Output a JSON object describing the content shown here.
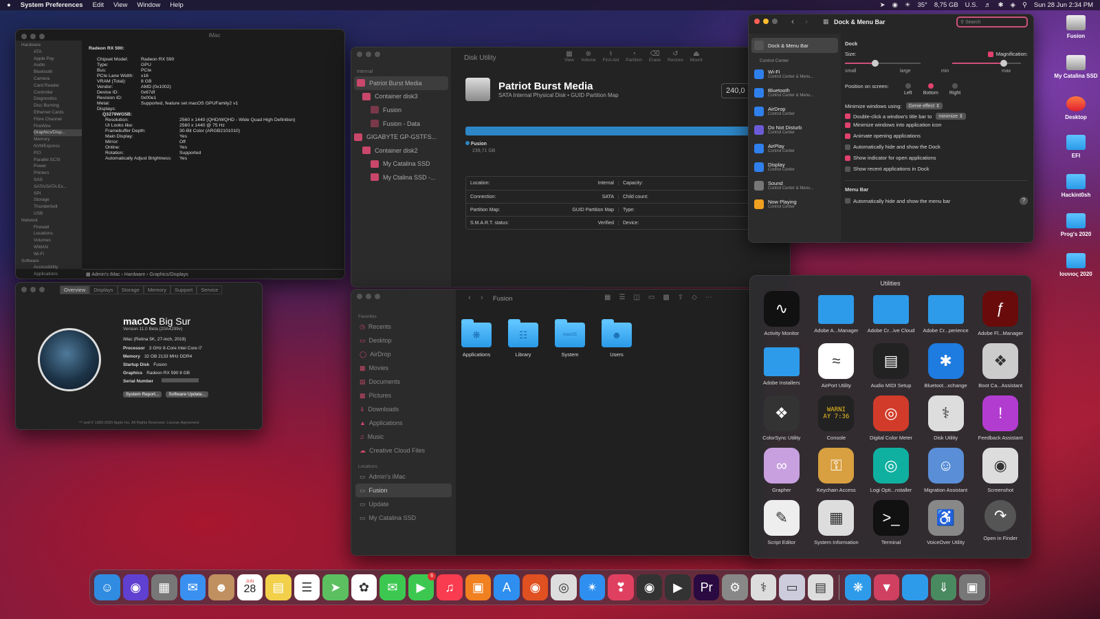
{
  "menubar": {
    "apple": "",
    "app": "System Preferences",
    "items": [
      "Edit",
      "View",
      "Window",
      "Help"
    ],
    "temp": "35°",
    "disk": "8,75 GB",
    "locale": "U.S.",
    "clock": "Sun 28 Jun  2:34 PM"
  },
  "sysinfo": {
    "title": "iMac",
    "sidebar": [
      "Hardware",
      "ATA",
      "Apple Pay",
      "Audio",
      "Bluetooth",
      "Camera",
      "Card Reader",
      "Controller",
      "Diagnostics",
      "Disc Burning",
      "Ethernet Cards",
      "Fibre Channel",
      "FireWire",
      "Graphics/Disp...",
      "Memory",
      "NVMExpress",
      "PCI",
      "Parallel SCSI",
      "Power",
      "Printers",
      "SAS",
      "SATA/SATA Ex...",
      "SPI",
      "Storage",
      "Thunderbolt",
      "USB",
      "Network",
      "Firewall",
      "Locations",
      "Volumes",
      "WWAN",
      "Wi-Fi",
      "Software",
      "Accessibility",
      "Applications",
      "Developer"
    ],
    "heading": "Radeon RX 590:",
    "rows": [
      [
        "Chipset Model:",
        "Radeon RX 590"
      ],
      [
        "Type:",
        "GPU"
      ],
      [
        "Bus:",
        "PCIe"
      ],
      [
        "PCIe Lane Width:",
        "x16"
      ],
      [
        "VRAM (Total):",
        "8 GB"
      ],
      [
        "Vendor:",
        "AMD (0x1002)"
      ],
      [
        "Device ID:",
        "0x67df"
      ],
      [
        "Revision ID:",
        "0x00e1"
      ],
      [
        "Metal:",
        "Supported, feature set macOS GPUFamily2 v1"
      ],
      [
        "Displays:",
        ""
      ]
    ],
    "display_name": "Q3279WG5B:",
    "display_rows": [
      [
        "Resolution:",
        "2560 x 1440 (QHD/WQHD - Wide Quad High Definition)"
      ],
      [
        "UI Looks like:",
        "2560 x 1440 @ 75 Hz"
      ],
      [
        "Framebuffer Depth:",
        "30-Bit Color (ARGB2101010)"
      ],
      [
        "Main Display:",
        "Yes"
      ],
      [
        "Mirror:",
        "Off"
      ],
      [
        "Online:",
        "Yes"
      ],
      [
        "Rotation:",
        "Supported"
      ],
      [
        "Automatically Adjust Brightness:",
        "Yes"
      ]
    ],
    "path": "Admin's iMac › Hardware › Graphics/Displays"
  },
  "about": {
    "tabs": [
      "Overview",
      "Displays",
      "Storage",
      "Memory",
      "Support",
      "Service"
    ],
    "os": "macOS",
    "os_name": "Big Sur",
    "version": "Version 11.0 Beta (20A4299v)",
    "model": "iMac (Retina 5K, 27-inch, 2019)",
    "specs": [
      [
        "Processor",
        "3 GHz 8-Core Intel Core i7"
      ],
      [
        "Memory",
        "32 GB 2133 MHz DDR4"
      ],
      [
        "Startup Disk",
        "Fusion"
      ],
      [
        "Graphics",
        "Radeon RX 590 8 GB"
      ],
      [
        "Serial Number",
        ""
      ]
    ],
    "btn_report": "System Report...",
    "btn_update": "Software Update...",
    "footer": "™ and © 1983-2020 Apple Inc. All Rights Reserved. License Agreement"
  },
  "disk": {
    "title": "Disk Utility",
    "toolbar": [
      "View",
      "Volume",
      "First Aid",
      "Partition",
      "Erase",
      "Restore",
      "Mount"
    ],
    "section": "Internal",
    "tree": [
      "Patriot Burst Media",
      "Container disk3",
      "Fusion",
      "Fusion - Data",
      "GIGABYTE GP-GSTFS...",
      "Container disk2",
      "My Catalina SSD",
      "My Ctalina SSD -..."
    ],
    "name": "Patriot Burst Media",
    "sub": "SATA Internal Physical Disk • GUID Partition Map",
    "size": "240,0",
    "vol": "Fusion",
    "vol_size": "239,71 GB",
    "info": [
      [
        "Location:",
        "Internal",
        "Capacity:",
        "24"
      ],
      [
        "Connection:",
        "SATA",
        "Child count:",
        ""
      ],
      [
        "Partition Map:",
        "GUID Partition Map",
        "Type:",
        "Sc"
      ],
      [
        "S.M.A.R.T. status:",
        "Verified",
        "Device:",
        ""
      ]
    ]
  },
  "finder": {
    "title": "Fusion",
    "fav_label": "Favorites",
    "favorites": [
      "Recents",
      "Desktop",
      "AirDrop",
      "Movies",
      "Documents",
      "Pictures",
      "Downloads",
      "Applications",
      "Music",
      "Creative Cloud Files"
    ],
    "loc_label": "Locations",
    "locations": [
      "Admin's iMac",
      "Fusion",
      "Update",
      "My Catalina SSD"
    ],
    "items": [
      "Applications",
      "Library",
      "System",
      "Users"
    ],
    "system_badge": "macOS"
  },
  "dockpref": {
    "title": "Dock & Menu Bar",
    "search": "Search",
    "sidebar": [
      [
        "Dock & Menu Bar",
        ""
      ],
      [
        "Wi-Fi",
        "Control Center & Menu..."
      ],
      [
        "Bluetooth",
        "Control Center & Menu..."
      ],
      [
        "AirDrop",
        "Control Center"
      ],
      [
        "Do Not Disturb",
        "Control Center"
      ],
      [
        "AirPlay",
        "Control Center"
      ],
      [
        "Display",
        "Control Center"
      ],
      [
        "Sound",
        "Control Center & Menu..."
      ],
      [
        "Now Playing",
        "Control Center"
      ]
    ],
    "cc_label": "Control Center",
    "dock_label": "Dock",
    "size_label": "Size:",
    "mag_label": "Magnification:",
    "small": "small",
    "large": "large",
    "min": "min",
    "max": "max",
    "position_label": "Position on screen:",
    "positions": [
      "Left",
      "Bottom",
      "Right"
    ],
    "minimize_label": "Minimize windows using:",
    "minimize_value": "Genie effect",
    "dbl_label": "Double-click a window's title bar to",
    "dbl_value": "minimize",
    "options": [
      [
        "Minimize windows into application icon",
        true
      ],
      [
        "Animate opening applications",
        true
      ],
      [
        "Automatically hide and show the Dock",
        false
      ],
      [
        "Show indicator for open applications",
        true
      ],
      [
        "Show recent applications in Dock",
        false
      ]
    ],
    "menubar_label": "Menu Bar",
    "menubar_opt": "Automatically hide and show the menu bar",
    "help": "?",
    "size_value": 0.4,
    "mag_value": 0.75
  },
  "utilities": {
    "title": "Utilities",
    "apps": [
      "Activity Monitor",
      "Adobe A...Manager",
      "Adobe Cr...ive Cloud",
      "Adobe Cr...perience",
      "Adobe Fl...Manager",
      "Adobe Installers",
      "AirPort Utility",
      "Audio MIDI Setup",
      "Bluetoot...xchange",
      "Boot Ca...Assistant",
      "ColorSync Utility",
      "Console",
      "Digital Color Meter",
      "Disk Utility",
      "Feedback Assistant",
      "Grapher",
      "Keychain Access",
      "Logi Opti...nstaller",
      "Migration Assistant",
      "Screenshot",
      "Script Editor",
      "System Information",
      "Terminal",
      "VoiceOver Utility",
      "Open in Finder"
    ],
    "console_text": "WARNI AY 7:36"
  },
  "desktop": [
    "Fusion",
    "My Catalina SSD",
    "Desktop",
    "EFI",
    "Hackint0sh",
    "Prog's 2020",
    "Ιουνιος 2020"
  ],
  "dock": {
    "calendar_month": "JUN",
    "calendar_day": "28",
    "facetime_badge": "6"
  }
}
